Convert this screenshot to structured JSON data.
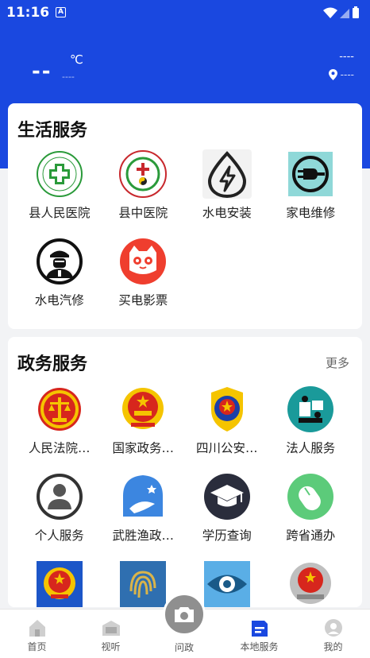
{
  "status": {
    "time": "11:16",
    "notif": "A"
  },
  "weather": {
    "temp": "--",
    "unit": "℃",
    "desc": "----",
    "right_top": "----",
    "location": "----"
  },
  "life": {
    "title": "生活服务",
    "items": [
      {
        "label": "县人民医院",
        "icon": "hospital-cross-icon"
      },
      {
        "label": "县中医院",
        "icon": "tcm-hospital-icon"
      },
      {
        "label": "水电安装",
        "icon": "lightning-drop-icon"
      },
      {
        "label": "家电维修",
        "icon": "plug-icon"
      },
      {
        "label": "水电汽修",
        "icon": "mechanic-icon"
      },
      {
        "label": "买电影票",
        "icon": "cat-movie-icon"
      }
    ]
  },
  "gov": {
    "title": "政务服务",
    "more": "更多",
    "items": [
      {
        "label": "人民法院…",
        "icon": "court-emblem-icon"
      },
      {
        "label": "国家政务…",
        "icon": "national-emblem-icon"
      },
      {
        "label": "四川公安…",
        "icon": "police-emblem-icon"
      },
      {
        "label": "法人服务",
        "icon": "corporate-service-icon"
      },
      {
        "label": "个人服务",
        "icon": "person-icon"
      },
      {
        "label": "武胜渔政…",
        "icon": "fishery-icon"
      },
      {
        "label": "学历查询",
        "icon": "graduation-cap-icon"
      },
      {
        "label": "跨省通办",
        "icon": "mouse-icon"
      },
      {
        "label": "",
        "icon": "emblem-blue-icon"
      },
      {
        "label": "",
        "icon": "fingerprint-icon"
      },
      {
        "label": "",
        "icon": "eye-icon"
      },
      {
        "label": "",
        "icon": "tax-emblem-icon"
      }
    ]
  },
  "tabs": [
    {
      "label": "首页",
      "icon": "home-icon"
    },
    {
      "label": "视听",
      "icon": "media-icon"
    },
    {
      "label": "问政",
      "icon": "camera-icon"
    },
    {
      "label": "本地服务",
      "icon": "local-service-icon"
    },
    {
      "label": "我的",
      "icon": "profile-icon"
    }
  ],
  "colors": {
    "brand_blue": "#1a48e0",
    "tab_inactive": "#555555"
  }
}
